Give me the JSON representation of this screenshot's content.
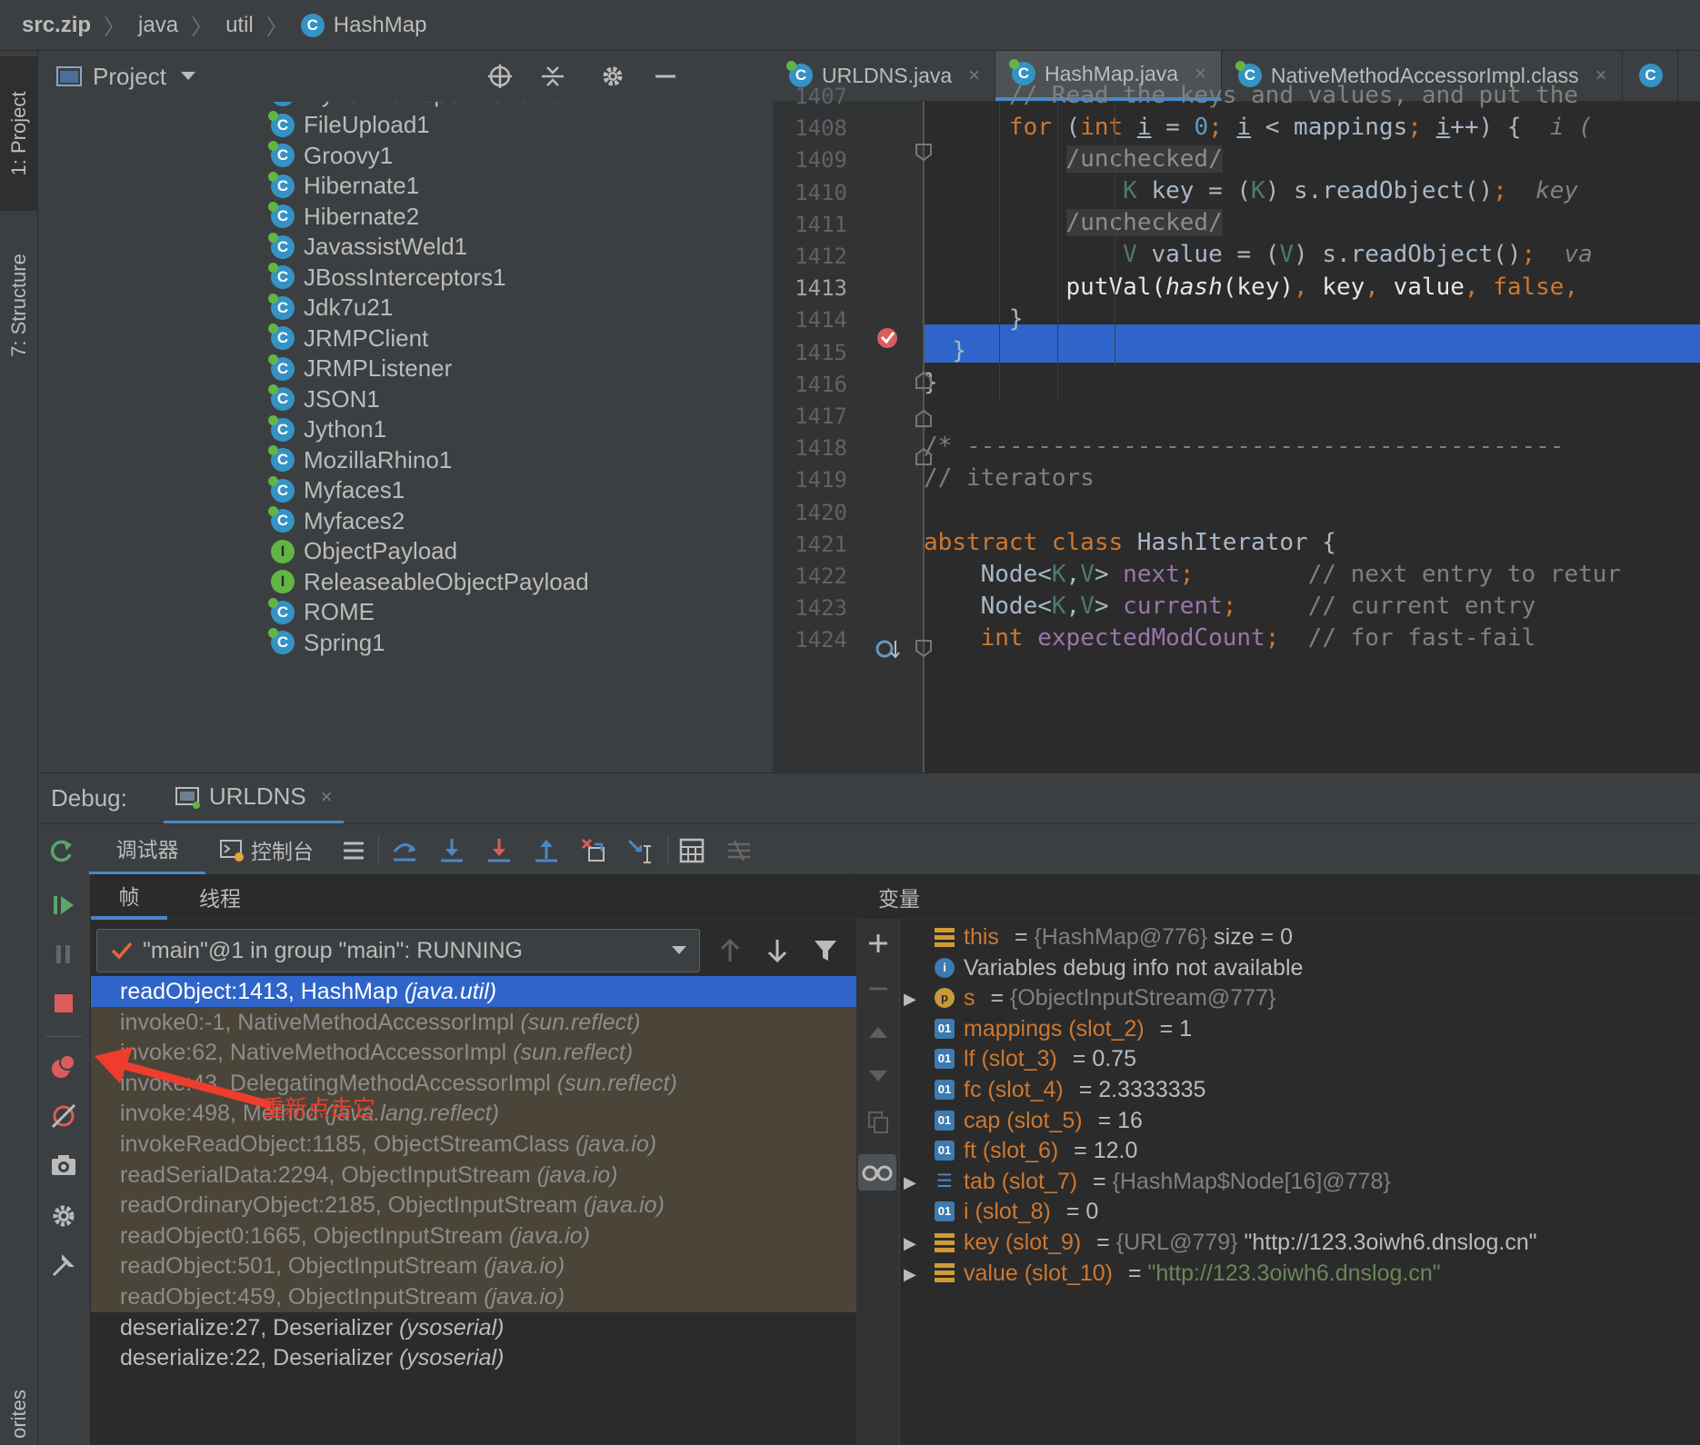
{
  "breadcrumb": [
    "src.zip",
    "java",
    "util",
    "HashMap"
  ],
  "sidebar_tabs": {
    "project": "1: Project",
    "structure": "7: Structure",
    "favorites": "orites"
  },
  "project_panel": {
    "title": "Project",
    "items": [
      {
        "name": "FileUpload1",
        "kind": "class"
      },
      {
        "name": "Groovy1",
        "kind": "class"
      },
      {
        "name": "Hibernate1",
        "kind": "class"
      },
      {
        "name": "Hibernate2",
        "kind": "class"
      },
      {
        "name": "JavassistWeld1",
        "kind": "class"
      },
      {
        "name": "JBossInterceptors1",
        "kind": "class"
      },
      {
        "name": "Jdk7u21",
        "kind": "class"
      },
      {
        "name": "JRMPClient",
        "kind": "class"
      },
      {
        "name": "JRMPListener",
        "kind": "class"
      },
      {
        "name": "JSON1",
        "kind": "class"
      },
      {
        "name": "Jython1",
        "kind": "class"
      },
      {
        "name": "MozillaRhino1",
        "kind": "class"
      },
      {
        "name": "Myfaces1",
        "kind": "class"
      },
      {
        "name": "Myfaces2",
        "kind": "class"
      },
      {
        "name": "ObjectPayload",
        "kind": "interface"
      },
      {
        "name": "ReleaseableObjectPayload",
        "kind": "interface"
      },
      {
        "name": "ROME",
        "kind": "class"
      },
      {
        "name": "Spring1",
        "kind": "class"
      }
    ]
  },
  "editor": {
    "tabs": [
      {
        "label": "URLDNS.java",
        "active": false
      },
      {
        "label": "HashMap.java",
        "active": true
      },
      {
        "label": "NativeMethodAccessorImpl.class",
        "active": false
      }
    ],
    "line_numbers": [
      "1407",
      "1408",
      "1409",
      "1410",
      "1411",
      "1412",
      "1413",
      "1414",
      "1415",
      "1416",
      "1417",
      "1418",
      "1419",
      "1420",
      "1421",
      "1422",
      "1423",
      "1424"
    ],
    "current_line": "1413"
  },
  "debug": {
    "label": "Debug:",
    "session": "URLDNS",
    "tab_debugger": "调试器",
    "tab_console": "控制台",
    "tab_frames": "帧",
    "tab_threads": "线程",
    "variables_title": "变量",
    "thread_select": "\"main\"@1 in group \"main\": RUNNING",
    "annotation": "重新点击它",
    "frames": [
      {
        "method": "readObject:1413, HashMap",
        "pkg": "(java.util)",
        "style": "sel"
      },
      {
        "method": "invoke0:-1, NativeMethodAccessorImpl",
        "pkg": "(sun.reflect)",
        "style": "lib"
      },
      {
        "method": "invoke:62, NativeMethodAccessorImpl",
        "pkg": "(sun.reflect)",
        "style": "lib"
      },
      {
        "method": "invoke:43, DelegatingMethodAccessorImpl",
        "pkg": "(sun.reflect)",
        "style": "lib"
      },
      {
        "method": "invoke:498, Method",
        "pkg": "(java.lang.reflect)",
        "style": "lib"
      },
      {
        "method": "invokeReadObject:1185, ObjectStreamClass",
        "pkg": "(java.io)",
        "style": "lib"
      },
      {
        "method": "readSerialData:2294, ObjectInputStream",
        "pkg": "(java.io)",
        "style": "lib"
      },
      {
        "method": "readOrdinaryObject:2185, ObjectInputStream",
        "pkg": "(java.io)",
        "style": "lib"
      },
      {
        "method": "readObject0:1665, ObjectInputStream",
        "pkg": "(java.io)",
        "style": "lib"
      },
      {
        "method": "readObject:501, ObjectInputStream",
        "pkg": "(java.io)",
        "style": "lib"
      },
      {
        "method": "readObject:459, ObjectInputStream",
        "pkg": "(java.io)",
        "style": "lib"
      },
      {
        "method": "deserialize:27, Deserializer",
        "pkg": "(ysoserial)",
        "style": "norm"
      },
      {
        "method": "deserialize:22, Deserializer",
        "pkg": "(ysoserial)",
        "style": "norm"
      }
    ],
    "variables": [
      {
        "name": "this",
        "eq": " = ",
        "val": "{HashMap@776}",
        "extra": " size = 0",
        "icon": "field",
        "expand": false,
        "valstyle": "grey"
      },
      {
        "name": "Variables debug info not available",
        "eq": "",
        "val": "",
        "extra": "",
        "icon": "info",
        "expand": false,
        "valstyle": "plain"
      },
      {
        "name": "s",
        "eq": " = ",
        "val": "{ObjectInputStream@777}",
        "extra": "",
        "icon": "param",
        "expand": true,
        "valstyle": "grey"
      },
      {
        "name": "mappings (slot_2)",
        "eq": " = ",
        "val": "1",
        "extra": "",
        "icon": "prim",
        "expand": false,
        "valstyle": "plain"
      },
      {
        "name": "lf (slot_3)",
        "eq": " = ",
        "val": "0.75",
        "extra": "",
        "icon": "prim",
        "expand": false,
        "valstyle": "plain"
      },
      {
        "name": "fc (slot_4)",
        "eq": " = ",
        "val": "2.3333335",
        "extra": "",
        "icon": "prim",
        "expand": false,
        "valstyle": "plain"
      },
      {
        "name": "cap (slot_5)",
        "eq": " = ",
        "val": "16",
        "extra": "",
        "icon": "prim",
        "expand": false,
        "valstyle": "plain"
      },
      {
        "name": "ft (slot_6)",
        "eq": " = ",
        "val": "12.0",
        "extra": "",
        "icon": "prim",
        "expand": false,
        "valstyle": "plain"
      },
      {
        "name": "tab (slot_7)",
        "eq": " = ",
        "val": "{HashMap$Node[16]@778}",
        "extra": "",
        "icon": "array",
        "expand": true,
        "valstyle": "grey"
      },
      {
        "name": "i (slot_8)",
        "eq": " = ",
        "val": "0",
        "extra": "",
        "icon": "prim",
        "expand": false,
        "valstyle": "plain"
      },
      {
        "name": "key (slot_9)",
        "eq": " = ",
        "val": "{URL@779}",
        "extra": " \"http://123.3oiwh6.dnslog.cn\"",
        "icon": "field",
        "expand": true,
        "valstyle": "grey"
      },
      {
        "name": "value (slot_10)",
        "eq": " = ",
        "val": "\"http://123.3oiwh6.dnslog.cn\"",
        "extra": "",
        "icon": "field",
        "expand": true,
        "valstyle": "str"
      }
    ]
  }
}
